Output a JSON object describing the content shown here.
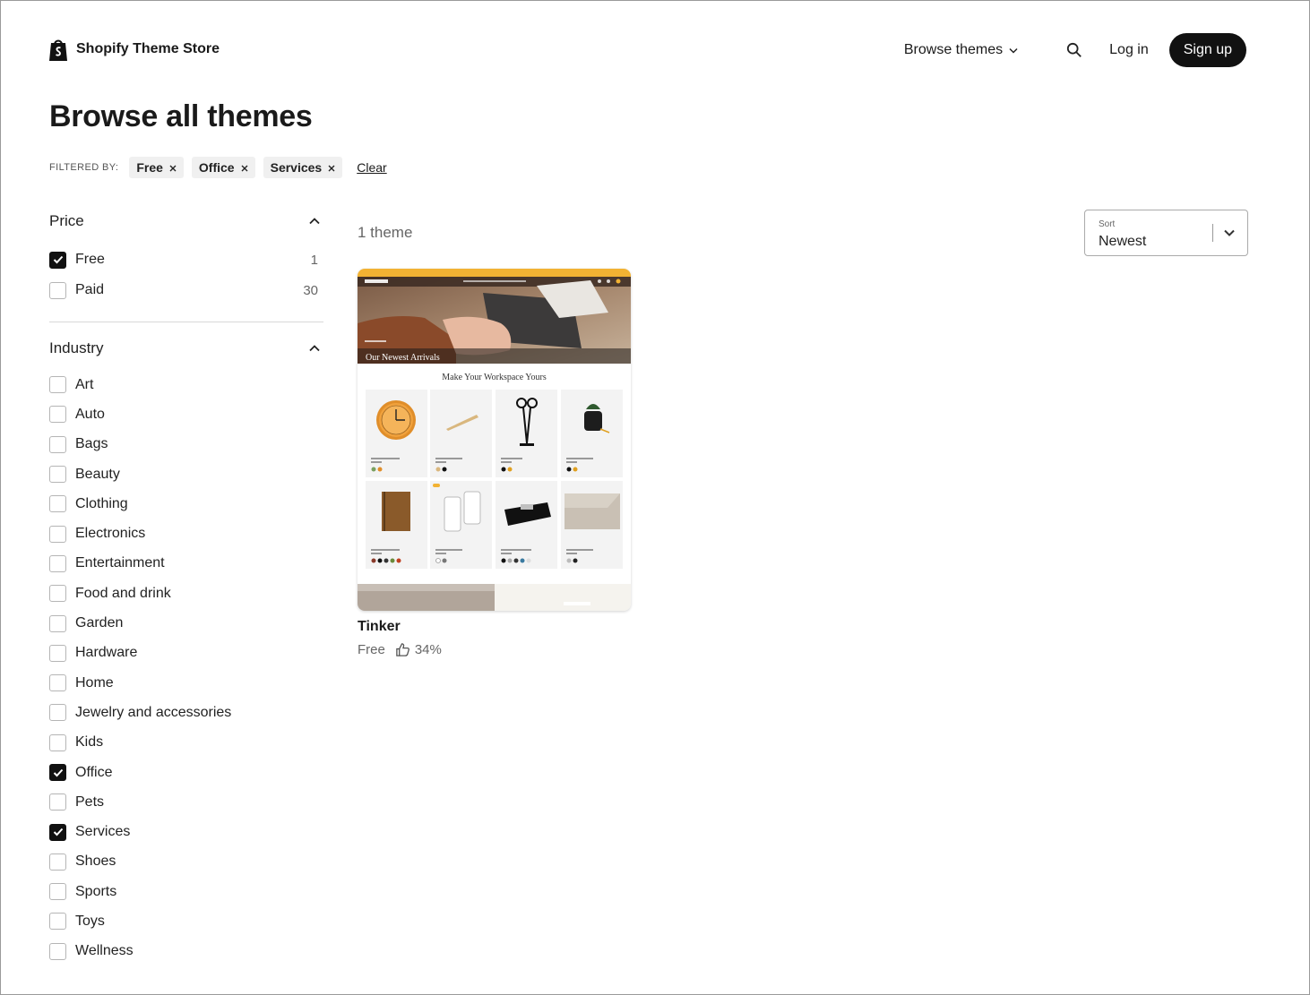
{
  "header": {
    "logo_text": "Shopify Theme Store",
    "nav": {
      "browse_label": "Browse themes",
      "login_label": "Log in",
      "signup_label": "Sign up"
    }
  },
  "page": {
    "title": "Browse all themes"
  },
  "filters": {
    "label": "FILTERED BY:",
    "chips": [
      "Free",
      "Office",
      "Services"
    ],
    "clear_label": "Clear"
  },
  "sidebar": {
    "price": {
      "title": "Price",
      "options": [
        {
          "label": "Free",
          "count": "1",
          "checked": true
        },
        {
          "label": "Paid",
          "count": "30",
          "checked": false
        }
      ]
    },
    "industry": {
      "title": "Industry",
      "options": [
        {
          "label": "Art",
          "checked": false
        },
        {
          "label": "Auto",
          "checked": false
        },
        {
          "label": "Bags",
          "checked": false
        },
        {
          "label": "Beauty",
          "checked": false
        },
        {
          "label": "Clothing",
          "checked": false
        },
        {
          "label": "Electronics",
          "checked": false
        },
        {
          "label": "Entertainment",
          "checked": false
        },
        {
          "label": "Food and drink",
          "checked": false
        },
        {
          "label": "Garden",
          "checked": false
        },
        {
          "label": "Hardware",
          "checked": false
        },
        {
          "label": "Home",
          "checked": false
        },
        {
          "label": "Jewelry and accessories",
          "checked": false
        },
        {
          "label": "Kids",
          "checked": false
        },
        {
          "label": "Office",
          "checked": true
        },
        {
          "label": "Pets",
          "checked": false
        },
        {
          "label": "Services",
          "checked": true
        },
        {
          "label": "Shoes",
          "checked": false
        },
        {
          "label": "Sports",
          "checked": false
        },
        {
          "label": "Toys",
          "checked": false
        },
        {
          "label": "Wellness",
          "checked": false
        }
      ]
    }
  },
  "results": {
    "count_label": "1 theme",
    "sort": {
      "label": "Sort",
      "value": "Newest"
    },
    "themes": [
      {
        "name": "Tinker",
        "price": "Free",
        "rating": "34%",
        "preview": {
          "hero_text": "Our Newest Arrivals",
          "section_title": "Make Your Workspace Yours"
        }
      }
    ]
  },
  "colors": {
    "primary": "#111111",
    "text_muted": "#666666",
    "preview_banner": "#f2b233",
    "chip_bg": "#f0f0f0"
  },
  "icons": [
    "shopify-bag-icon",
    "chevron-down-icon",
    "search-icon",
    "close-icon",
    "chevron-up-icon",
    "checkmark-icon",
    "thumbs-up-icon"
  ]
}
